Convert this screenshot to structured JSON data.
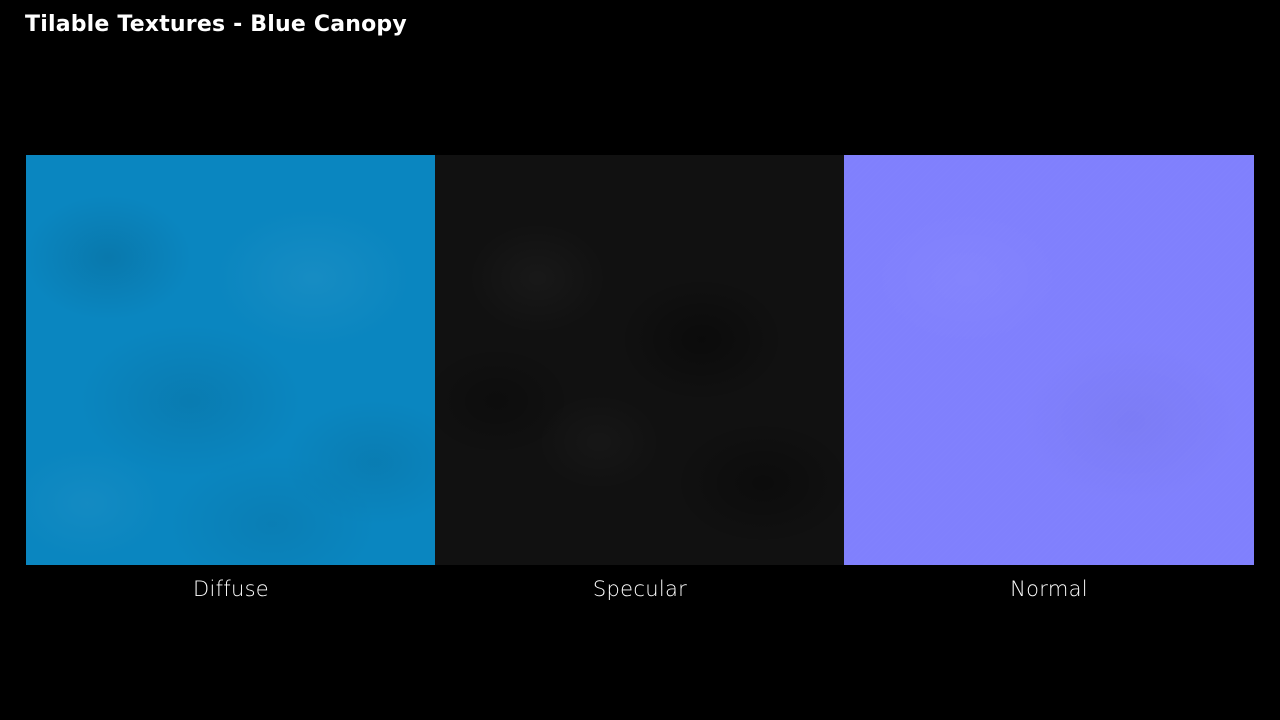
{
  "header": {
    "title": "Tilable Textures - Blue Canopy"
  },
  "panels": [
    {
      "label": "Diffuse",
      "color": "#0a86c0"
    },
    {
      "label": "Specular",
      "color": "#111111"
    },
    {
      "label": "Normal",
      "color": "#8080fd"
    }
  ],
  "colors": {
    "background": "#000000",
    "text": "#ffffff"
  }
}
